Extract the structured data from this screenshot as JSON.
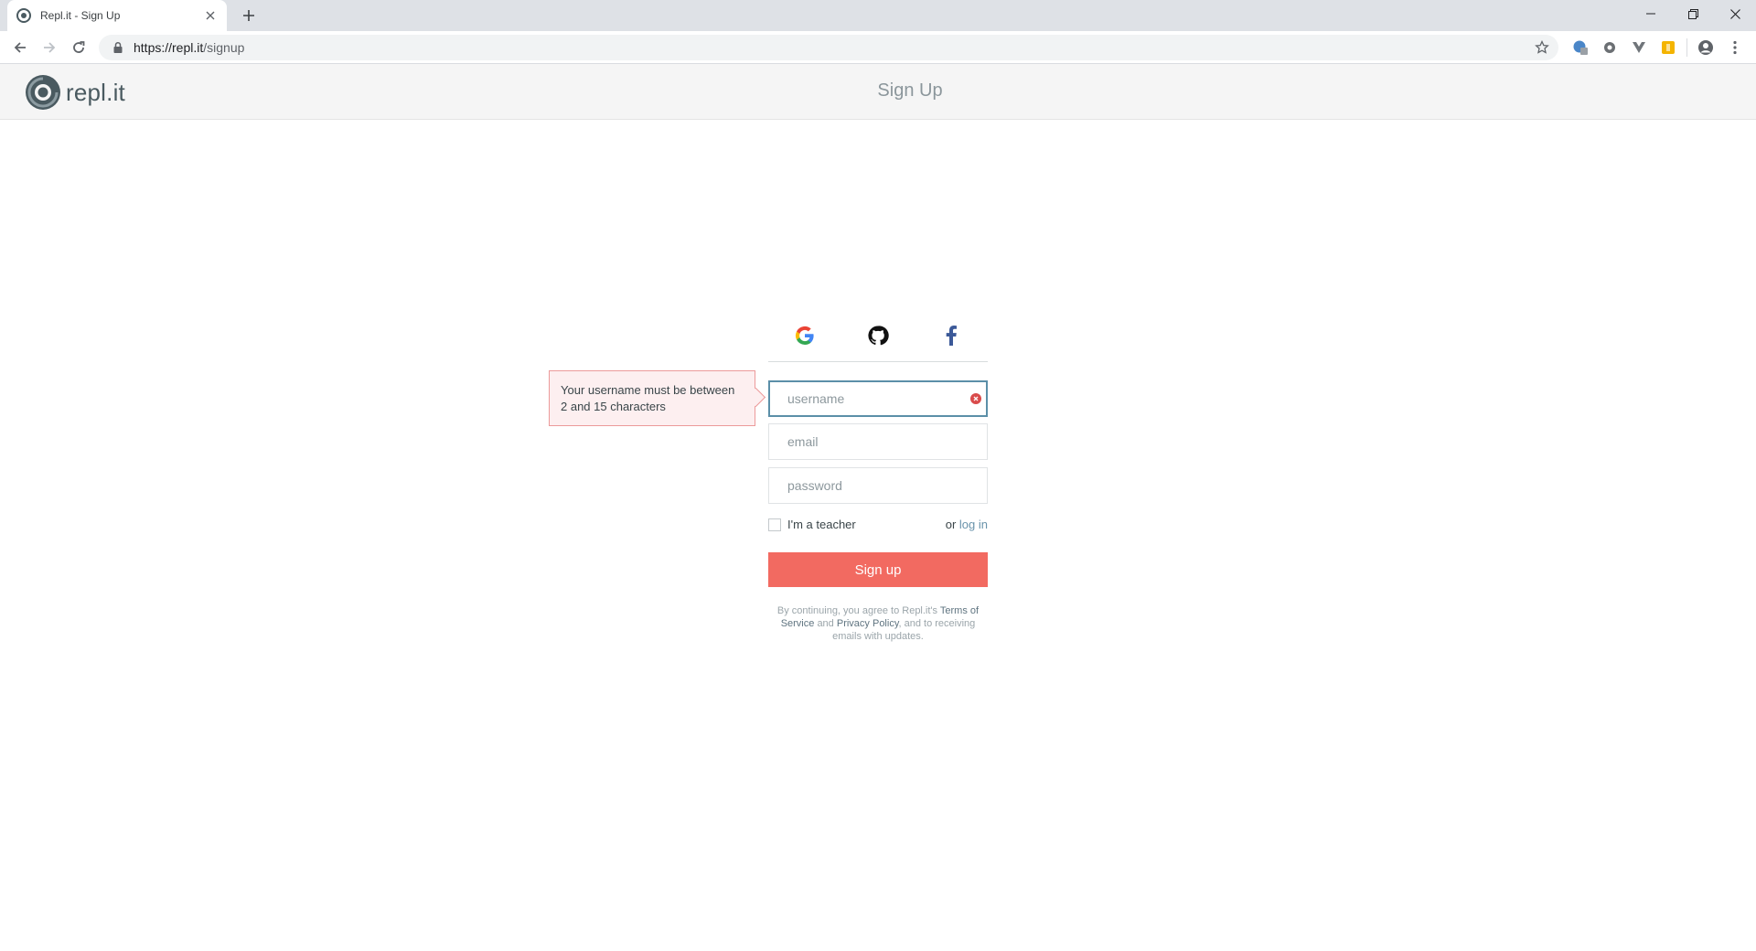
{
  "browser": {
    "tab": {
      "title": "Repl.it - Sign Up"
    },
    "url": {
      "host": "https://repl.it",
      "path": "/signup"
    }
  },
  "header": {
    "logo_text": "repl.it",
    "title": "Sign Up"
  },
  "form": {
    "tooltip": "Your username must be between 2 and 15 characters",
    "username": {
      "value": "",
      "placeholder": "username"
    },
    "email": {
      "value": "",
      "placeholder": "email"
    },
    "password": {
      "value": "",
      "placeholder": "password"
    },
    "teacher_label": "I'm a teacher",
    "teacher_checked": false,
    "or_text": "or",
    "login_link": "log in",
    "submit_label": "Sign up"
  },
  "terms": {
    "prefix": "By continuing, you agree to Repl.it's",
    "tos_link": "Terms of Service",
    "and_text": "and",
    "privacy_link": "Privacy Policy",
    "suffix": ", and to receiving emails with updates."
  },
  "colors": {
    "accent_red": "#f26a61",
    "link_blue": "#6993ab",
    "focus_border": "#5b8fa8",
    "error_dot": "#d94b4b"
  }
}
